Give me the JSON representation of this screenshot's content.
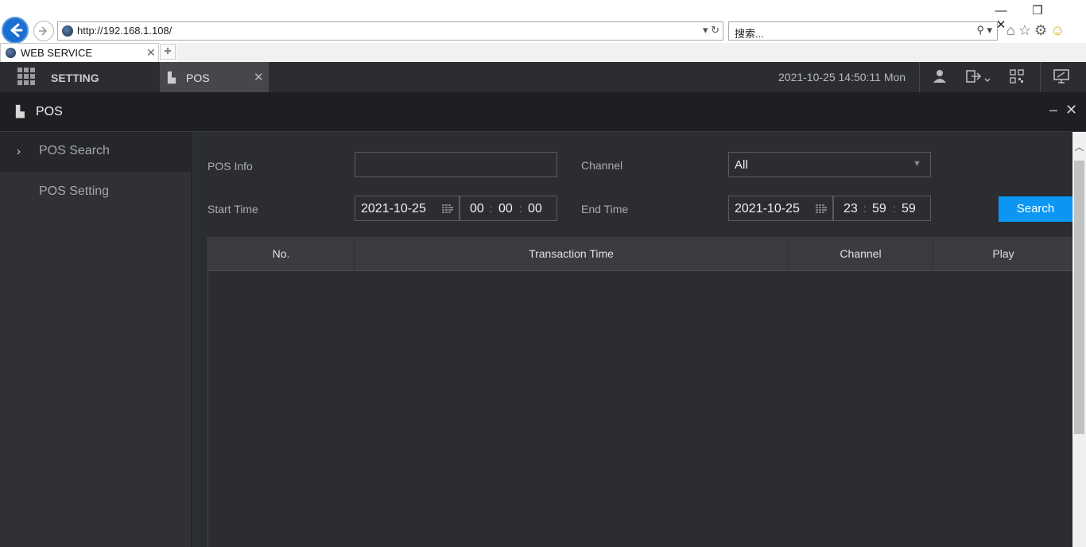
{
  "browser": {
    "url": "http://192.168.1.108/",
    "search_placeholder": "搜索...",
    "tab_title": "WEB SERVICE"
  },
  "app_nav": {
    "setting_label": "SETTING",
    "tab_label": "POS",
    "datetime": "2021-10-25 14:50:11 Mon"
  },
  "pos_header": {
    "title": "POS"
  },
  "sidebar": {
    "items": [
      {
        "label": "POS Search",
        "selected": true
      },
      {
        "label": "POS Setting",
        "selected": false
      }
    ]
  },
  "form": {
    "pos_info_label": "POS Info",
    "pos_info_value": "",
    "channel_label": "Channel",
    "channel_value": "All",
    "start_time_label": "Start Time",
    "start_date": "2021-10-25",
    "start_hh": "00",
    "start_mm": "00",
    "start_ss": "00",
    "end_time_label": "End Time",
    "end_date": "2021-10-25",
    "end_hh": "23",
    "end_mm": "59",
    "end_ss": "59",
    "search_button": "Search"
  },
  "table": {
    "columns": [
      "No.",
      "Transaction Time",
      "Channel",
      "Play"
    ],
    "rows": []
  },
  "colors": {
    "accent": "#0b96f3",
    "background": "#2b2d31",
    "header_bg": "#1e1f22"
  }
}
